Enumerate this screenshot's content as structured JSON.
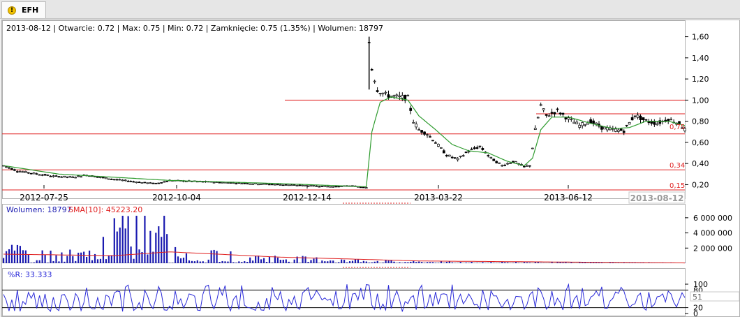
{
  "tab": {
    "icon": "warning-icon",
    "label": "EFH"
  },
  "colors": {
    "price": "#000000",
    "sma_price": "#2e9b2e",
    "level_line": "#e02020",
    "volume_bar": "#1a1ab0",
    "volume_sma": "#e02020",
    "wr_line": "#2a2ad8"
  },
  "chart_data": [
    {
      "type": "candlestick",
      "info_line": {
        "date": "2013-08-12",
        "items": [
          "Otwarcie: 0.72",
          "Max: 0.75",
          "Min: 0.72",
          "Zamknięcie: 0.75 (1.35%)",
          "Wolumen: 18797"
        ]
      },
      "y_ticks": [
        "1,60",
        "1,40",
        "1,20",
        "1,00",
        "0,80",
        "0,60",
        "0,40",
        "0,20"
      ],
      "ylim": [
        0.15,
        1.65
      ],
      "x_ticks": [
        "2012-07-25",
        "2012-10-04",
        "2012-12-14",
        "2013-03-22",
        "2013-06-12"
      ],
      "current_date_label": "2013-08-12",
      "levels": [
        {
          "value": 1.0,
          "label": ""
        },
        {
          "value": 0.87,
          "label": ""
        },
        {
          "value": 0.68,
          "label": ""
        },
        {
          "value": 0.34,
          "label": "0,34"
        },
        {
          "value": 0.15,
          "label": "0,15"
        }
      ],
      "price_marker": "0,75",
      "price_anchors": [
        [
          0,
          0.38
        ],
        [
          5,
          0.33
        ],
        [
          10,
          0.31
        ],
        [
          18,
          0.28
        ],
        [
          25,
          0.27
        ],
        [
          30,
          0.29
        ],
        [
          40,
          0.25
        ],
        [
          50,
          0.22
        ],
        [
          55,
          0.21
        ],
        [
          60,
          0.24
        ],
        [
          70,
          0.23
        ],
        [
          80,
          0.22
        ],
        [
          90,
          0.21
        ],
        [
          100,
          0.2
        ],
        [
          110,
          0.19
        ],
        [
          120,
          0.18
        ],
        [
          125,
          0.19
        ],
        [
          131,
          0.17
        ],
        [
          132,
          1.55
        ],
        [
          133,
          1.3
        ],
        [
          135,
          1.1
        ],
        [
          138,
          1.05
        ],
        [
          142,
          1.03
        ],
        [
          146,
          1.02
        ],
        [
          148,
          0.8
        ],
        [
          150,
          0.72
        ],
        [
          153,
          0.68
        ],
        [
          156,
          0.6
        ],
        [
          160,
          0.48
        ],
        [
          164,
          0.44
        ],
        [
          168,
          0.52
        ],
        [
          172,
          0.56
        ],
        [
          176,
          0.45
        ],
        [
          180,
          0.38
        ],
        [
          184,
          0.42
        ],
        [
          188,
          0.37
        ],
        [
          190,
          0.38
        ],
        [
          192,
          0.72
        ],
        [
          194,
          0.95
        ],
        [
          196,
          0.85
        ],
        [
          200,
          0.9
        ],
        [
          204,
          0.82
        ],
        [
          208,
          0.76
        ],
        [
          212,
          0.8
        ],
        [
          216,
          0.74
        ],
        [
          220,
          0.72
        ],
        [
          224,
          0.71
        ],
        [
          228,
          0.86
        ],
        [
          232,
          0.8
        ],
        [
          236,
          0.78
        ],
        [
          240,
          0.82
        ],
        [
          244,
          0.78
        ],
        [
          246,
          0.72
        ]
      ],
      "sma_anchors": [
        [
          0,
          0.38
        ],
        [
          20,
          0.3
        ],
        [
          60,
          0.24
        ],
        [
          100,
          0.21
        ],
        [
          131,
          0.18
        ],
        [
          133,
          0.7
        ],
        [
          136,
          0.98
        ],
        [
          140,
          1.03
        ],
        [
          146,
          1.0
        ],
        [
          150,
          0.85
        ],
        [
          156,
          0.72
        ],
        [
          162,
          0.58
        ],
        [
          168,
          0.52
        ],
        [
          175,
          0.5
        ],
        [
          182,
          0.42
        ],
        [
          188,
          0.38
        ],
        [
          191,
          0.45
        ],
        [
          194,
          0.72
        ],
        [
          198,
          0.84
        ],
        [
          204,
          0.84
        ],
        [
          212,
          0.78
        ],
        [
          220,
          0.73
        ],
        [
          226,
          0.74
        ],
        [
          232,
          0.8
        ],
        [
          240,
          0.8
        ],
        [
          246,
          0.76
        ]
      ]
    },
    {
      "type": "bar",
      "title": "Wolumen: 18797",
      "sma_label": "SMA[10]: 45223.20",
      "y_ticks": [
        "6 000 000",
        "4 000 000",
        "2 000 000"
      ],
      "ylim": [
        0,
        7000000
      ],
      "volume_anchors": [
        [
          0,
          1400000
        ],
        [
          30,
          900000
        ],
        [
          58,
          7500000
        ],
        [
          60,
          1200000
        ],
        [
          100,
          600000
        ],
        [
          131,
          300000
        ],
        [
          150,
          150000
        ],
        [
          190,
          120000
        ],
        [
          246,
          60000
        ]
      ],
      "sma_anchors": [
        [
          0,
          1200000
        ],
        [
          40,
          1000000
        ],
        [
          60,
          1500000
        ],
        [
          100,
          800000
        ],
        [
          131,
          500000
        ],
        [
          150,
          300000
        ],
        [
          246,
          40000
        ]
      ]
    },
    {
      "type": "line",
      "title": "%R: 33.333",
      "y_ticks": [
        "100",
        "80",
        "20",
        "0"
      ],
      "ylim": [
        0,
        100
      ],
      "value_box": "51"
    }
  ]
}
